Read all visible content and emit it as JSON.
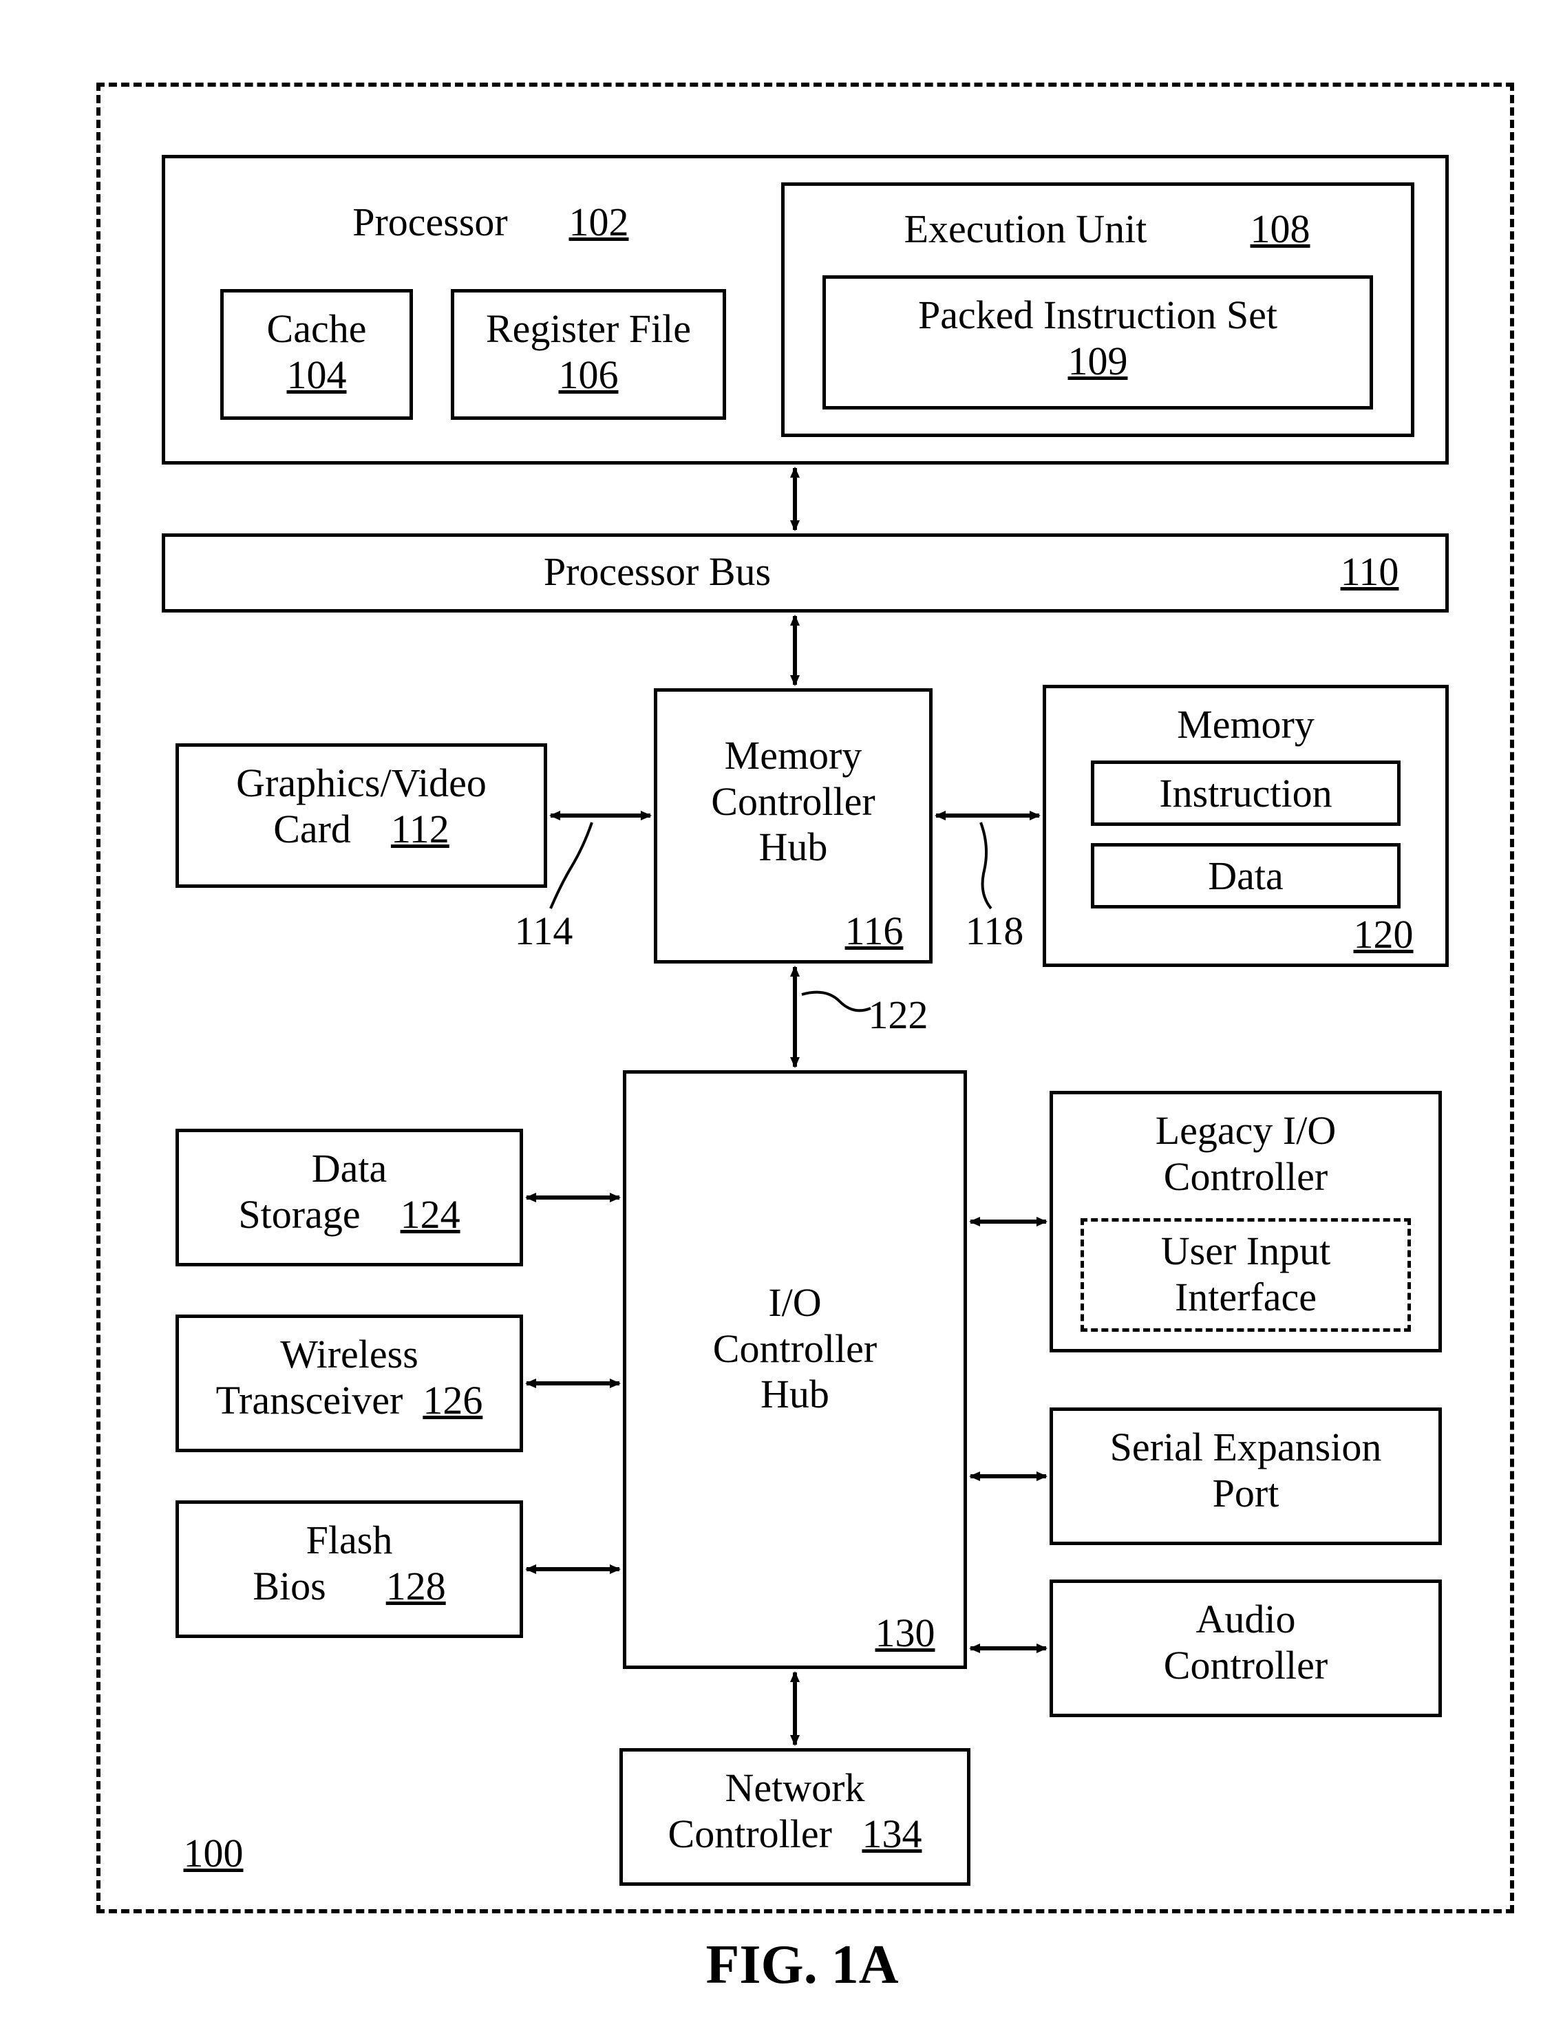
{
  "system": {
    "ref": "100"
  },
  "processor": {
    "label": "Processor",
    "ref": "102"
  },
  "cache": {
    "label": "Cache",
    "ref": "104"
  },
  "register_file": {
    "label": "Register File",
    "ref": "106"
  },
  "execution_unit": {
    "label": "Execution Unit",
    "ref": "108"
  },
  "packed_instruction_set": {
    "label": "Packed Instruction Set",
    "ref": "109"
  },
  "processor_bus": {
    "label": "Processor Bus",
    "ref": "110"
  },
  "graphics_card": {
    "line1": "Graphics/Video",
    "line2": "Card",
    "ref": "112"
  },
  "bus_114": {
    "ref": "114"
  },
  "memory_controller_hub": {
    "line1": "Memory",
    "line2": "Controller",
    "line3": "Hub",
    "ref": "116"
  },
  "bus_118": {
    "ref": "118"
  },
  "memory": {
    "label": "Memory",
    "ref": "120"
  },
  "instruction": {
    "label": "Instruction"
  },
  "data_mem": {
    "label": "Data"
  },
  "bus_122": {
    "ref": "122"
  },
  "data_storage": {
    "line1": "Data",
    "line2": "Storage",
    "ref": "124"
  },
  "wireless_transceiver": {
    "line1": "Wireless",
    "line2": "Transceiver",
    "ref": "126"
  },
  "flash_bios": {
    "line1": "Flash",
    "line2": "Bios",
    "ref": "128"
  },
  "io_controller_hub": {
    "line1": "I/O",
    "line2": "Controller",
    "line3": "Hub",
    "ref": "130"
  },
  "legacy_io": {
    "line1": "Legacy I/O",
    "line2": "Controller"
  },
  "user_input": {
    "line1": "User Input",
    "line2": "Interface"
  },
  "serial_expansion": {
    "line1": "Serial Expansion",
    "line2": "Port"
  },
  "audio_controller": {
    "line1": "Audio",
    "line2": "Controller"
  },
  "network_controller": {
    "line1": "Network",
    "line2": "Controller",
    "ref": "134"
  },
  "figure": {
    "label": "FIG. 1A"
  }
}
